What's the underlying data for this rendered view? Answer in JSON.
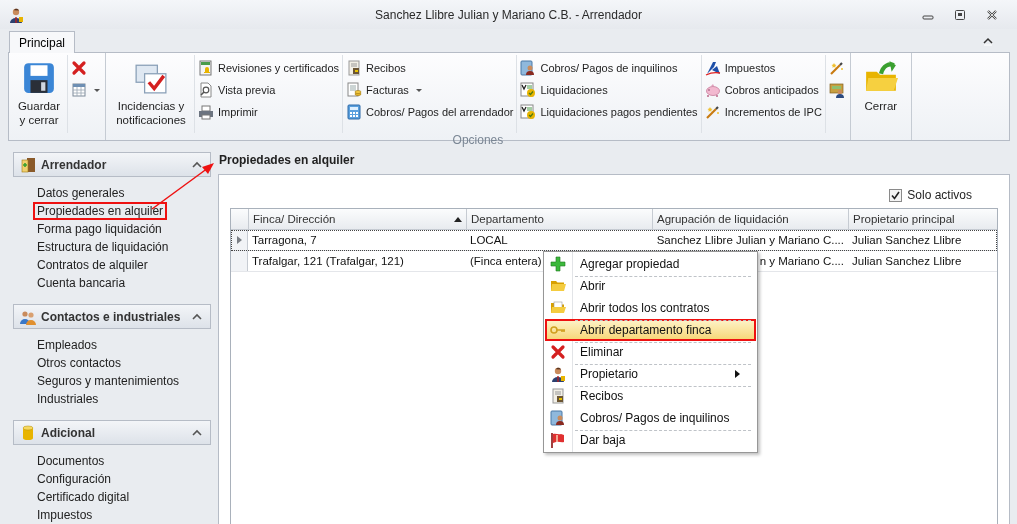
{
  "window": {
    "title": "Sanchez Llibre Julian y Mariano C.B. - Arrendador"
  },
  "ribbon": {
    "tabs": [
      {
        "label": "Principal",
        "selected": true
      }
    ],
    "groups": [
      {
        "sections": [
          {
            "kind": "large",
            "items": [
              {
                "label": "Guardar y cerrar",
                "dropdown": false
              }
            ]
          },
          {
            "kind": "stack",
            "items": [
              {
                "dropdown": false
              },
              {
                "dropdown": true
              }
            ]
          }
        ]
      },
      {
        "label": "Opciones",
        "sections": [
          {
            "kind": "large",
            "items": [
              {
                "label": "Incidencias y notificaciones",
                "dropdown": false
              }
            ]
          },
          {
            "kind": "stack",
            "items": [
              {
                "label": "Revisiones y certificados",
                "dropdown": false
              },
              {
                "label": "Vista previa",
                "dropdown": false
              },
              {
                "label": "Imprimir",
                "dropdown": false
              }
            ]
          },
          {
            "kind": "stack",
            "items": [
              {
                "label": "Recibos",
                "dropdown": false
              },
              {
                "label": "Facturas",
                "dropdown": true
              },
              {
                "label": "Cobros/ Pagos del arrendador",
                "dropdown": false
              }
            ]
          },
          {
            "kind": "stack",
            "items": [
              {
                "label": "Cobros/ Pagos de inquilinos",
                "dropdown": false
              },
              {
                "label": "Liquidaciones",
                "dropdown": false
              },
              {
                "label": "Liquidaciones pagos pendientes",
                "dropdown": false
              }
            ]
          },
          {
            "kind": "stack",
            "items": [
              {
                "label": "Impuestos",
                "dropdown": false
              },
              {
                "label": "Cobros anticipados",
                "dropdown": false
              },
              {
                "label": "Incrementos de IPC",
                "dropdown": false
              }
            ]
          },
          {
            "kind": "stack",
            "items": [
              {
                "dropdown": false
              },
              {
                "dropdown": false
              }
            ]
          }
        ]
      },
      {
        "sections": [
          {
            "kind": "large",
            "items": [
              {
                "label": "Cerrar",
                "dropdown": false
              }
            ]
          }
        ]
      }
    ]
  },
  "sidebar": {
    "groups": [
      {
        "title": "Arrendador",
        "expanded": true,
        "items": [
          {
            "label": "Datos generales",
            "marked": false
          },
          {
            "label": "Propiedades en alquiler",
            "marked": true
          },
          {
            "label": "Forma pago liquidación",
            "marked": false
          },
          {
            "label": "Estructura de liquidación",
            "marked": false
          },
          {
            "label": "Contratos de alquiler",
            "marked": false
          },
          {
            "label": "Cuenta bancaria",
            "marked": false
          }
        ]
      },
      {
        "title": "Contactos e industriales",
        "expanded": true,
        "items": [
          {
            "label": "Empleados",
            "marked": false
          },
          {
            "label": "Otros contactos",
            "marked": false
          },
          {
            "label": "Seguros y mantenimientos",
            "marked": false
          },
          {
            "label": "Industriales",
            "marked": false
          }
        ]
      },
      {
        "title": "Adicional",
        "expanded": true,
        "items": [
          {
            "label": "Documentos",
            "marked": false
          },
          {
            "label": "Configuración",
            "marked": false
          },
          {
            "label": "Certificado digital",
            "marked": false
          },
          {
            "label": "Impuestos",
            "marked": false
          }
        ]
      }
    ]
  },
  "panel": {
    "title": "Propiedades en alquiler",
    "filter": {
      "label": "Solo activos",
      "checked": true
    },
    "table": {
      "columns": [
        {
          "label": "Finca/ Dirección",
          "sorted": true
        },
        {
          "label": "Departamento",
          "sorted": false
        },
        {
          "label": "Agrupación de liquidación",
          "sorted": false
        },
        {
          "label": "Propietario principal",
          "sorted": false
        }
      ],
      "rows": [
        {
          "current": true,
          "cells": [
            "Tarragona, 7",
            "LOCAL",
            "Sanchez Llibre Julian y Mariano C....",
            "Julian Sanchez Llibre"
          ]
        },
        {
          "current": false,
          "cells": [
            "Trafalgar, 121 (Trafalgar, 121)",
            "(Finca entera)",
            "n y Mariano C....",
            "Julian Sanchez Llibre"
          ]
        }
      ]
    },
    "context_menu": {
      "items": [
        {
          "label": "Agregar propiedad",
          "group_start": false,
          "submenu": false,
          "selected": false,
          "marked": false
        },
        {
          "label": "Abrir",
          "group_start": true,
          "submenu": false,
          "selected": false,
          "marked": false
        },
        {
          "label": "Abrir todos los contratos",
          "group_start": false,
          "submenu": false,
          "selected": false,
          "marked": false
        },
        {
          "label": "Abrir departamento finca",
          "group_start": true,
          "submenu": false,
          "selected": true,
          "marked": true
        },
        {
          "label": "Eliminar",
          "group_start": true,
          "submenu": false,
          "selected": false,
          "marked": false
        },
        {
          "label": "Propietario",
          "group_start": true,
          "submenu": true,
          "selected": false,
          "marked": false
        },
        {
          "label": "Recibos",
          "group_start": true,
          "submenu": false,
          "selected": false,
          "marked": false
        },
        {
          "label": "Cobros/ Pagos de inquilinos",
          "group_start": false,
          "submenu": false,
          "selected": false,
          "marked": false
        },
        {
          "label": "Dar baja",
          "group_start": true,
          "submenu": false,
          "selected": false,
          "marked": false
        }
      ]
    }
  }
}
